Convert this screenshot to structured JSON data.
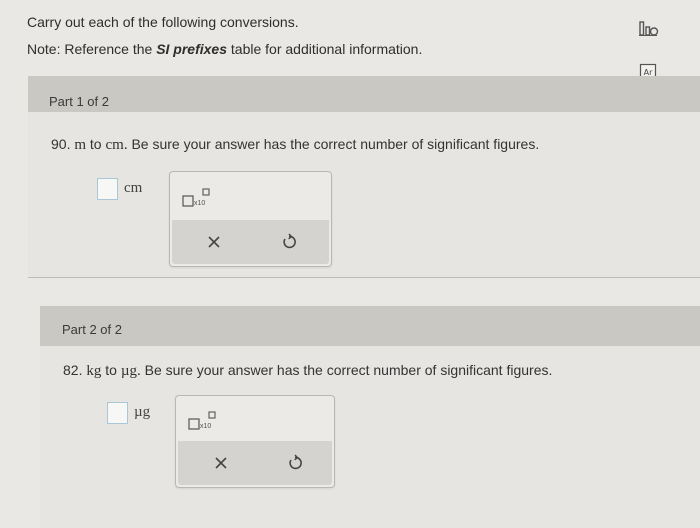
{
  "instructions": {
    "intro": "Carry out each of the following conversions.",
    "note_prefix": "Note: Reference the ",
    "note_bold": "SI prefixes",
    "note_suffix": " table for additional information."
  },
  "toolbar": {
    "icons": [
      "chart-icon",
      "periodic-table-icon"
    ]
  },
  "parts": [
    {
      "header": "Part 1 of 2",
      "question_value": "90.",
      "question_from": "m",
      "question_to_word": "to",
      "question_to": "cm.",
      "question_rest": "Be sure your answer has the correct number of significant figures.",
      "unit": "cm",
      "palette": {
        "sci_label": "x10"
      }
    },
    {
      "header": "Part 2 of 2",
      "question_value": "82.",
      "question_from": "kg",
      "question_to_word": "to",
      "question_to": "µg.",
      "question_rest": "Be sure your answer has the correct number of significant figures.",
      "unit": "µg",
      "palette": {
        "sci_label": "x10"
      }
    }
  ],
  "colors": {
    "background": "#e9e8e4",
    "part_header": "#c9c8c3",
    "answer_border": "#a9c7d6"
  }
}
